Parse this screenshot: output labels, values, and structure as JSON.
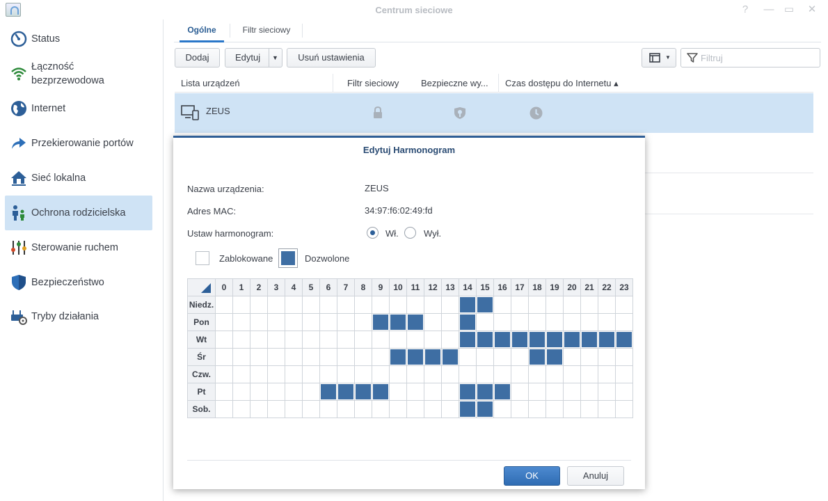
{
  "window": {
    "title": "Centrum sieciowe",
    "help": "?",
    "minimize": "—",
    "maximize": "▭",
    "close": "✕"
  },
  "sidebar": {
    "items": [
      {
        "label": "Status",
        "icon": "gauge-icon"
      },
      {
        "label": "Łączność bezprzewodowa",
        "icon": "wifi-icon"
      },
      {
        "label": "Internet",
        "icon": "globe-icon"
      },
      {
        "label": "Przekierowanie portów",
        "icon": "arrow-forward-icon"
      },
      {
        "label": "Sieć lokalna",
        "icon": "home-network-icon"
      },
      {
        "label": "Ochrona rodzicielska",
        "icon": "family-icon",
        "active": true
      },
      {
        "label": "Sterowanie ruchem",
        "icon": "sliders-icon"
      },
      {
        "label": "Bezpieczeństwo",
        "icon": "shield-icon"
      },
      {
        "label": "Tryby działania",
        "icon": "router-gear-icon"
      }
    ]
  },
  "tabs": [
    {
      "label": "Ogólne",
      "active": true
    },
    {
      "label": "Filtr sieciowy"
    }
  ],
  "toolbar": {
    "add": "Dodaj",
    "edit": "Edytuj",
    "remove_settings": "Usuń ustawienia",
    "filter_placeholder": "Filtruj"
  },
  "grid": {
    "columns": [
      "Lista urządzeń",
      "Filtr sieciowy",
      "Bezpieczne wy...",
      "Czas dostępu do Internetu ▴"
    ],
    "rows": [
      {
        "device": "ZEUS",
        "selected": true
      }
    ]
  },
  "dialog": {
    "title": "Edytuj Harmonogram",
    "device_name_label": "Nazwa urządzenia:",
    "device_name": "ZEUS",
    "mac_label": "Adres MAC:",
    "mac": "34:97:f6:02:49:fd",
    "schedule_label": "Ustaw harmonogram:",
    "on_label": "Wł.",
    "off_label": "Wył.",
    "schedule_on": true,
    "legend_blocked": "Zablokowane",
    "legend_allowed": "Dozwolone",
    "ok": "OK",
    "cancel": "Anuluj"
  },
  "schedule": {
    "hours": [
      "0",
      "1",
      "2",
      "3",
      "4",
      "5",
      "6",
      "7",
      "8",
      "9",
      "10",
      "11",
      "12",
      "13",
      "14",
      "15",
      "16",
      "17",
      "18",
      "19",
      "20",
      "21",
      "22",
      "23"
    ],
    "days": [
      {
        "label": "Niedz.",
        "allowed": [
          14,
          15
        ]
      },
      {
        "label": "Pon",
        "allowed": [
          9,
          10,
          11,
          14
        ]
      },
      {
        "label": "Wt",
        "allowed": [
          14,
          15,
          16,
          17,
          18,
          19,
          20,
          21,
          22,
          23
        ]
      },
      {
        "label": "Śr",
        "allowed": [
          10,
          11,
          12,
          13,
          18,
          19
        ]
      },
      {
        "label": "Czw.",
        "allowed": []
      },
      {
        "label": "Pt",
        "allowed": [
          6,
          7,
          8,
          9,
          14,
          15,
          16
        ]
      },
      {
        "label": "Sob.",
        "allowed": [
          14,
          15
        ]
      }
    ]
  },
  "colors": {
    "accent": "#2f5e96",
    "allowed_cell": "#3e6ea3",
    "selection": "#cfe3f5"
  }
}
